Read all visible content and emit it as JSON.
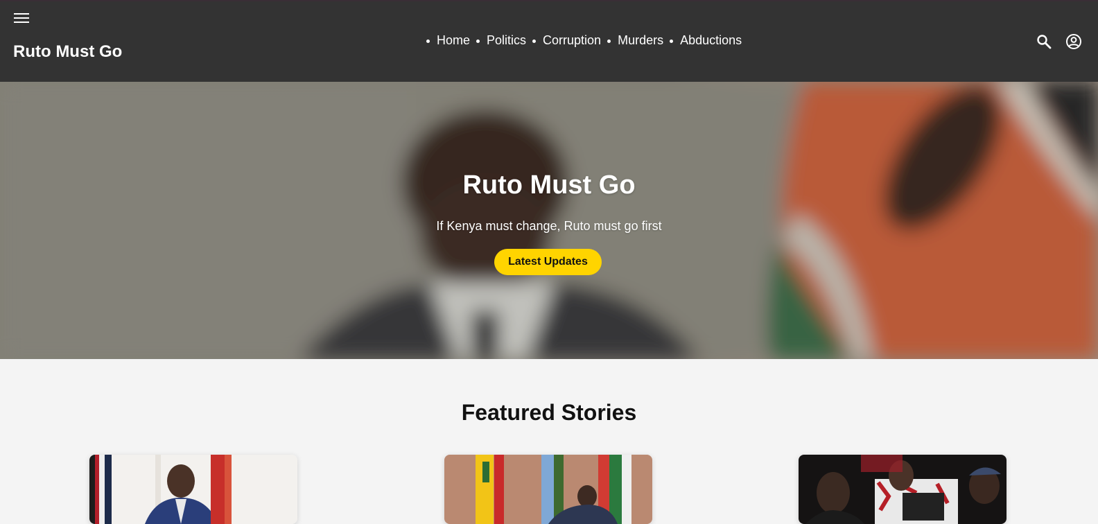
{
  "header": {
    "brand": "Ruto Must Go",
    "nav": [
      {
        "label": "Home"
      },
      {
        "label": "Politics"
      },
      {
        "label": "Corruption"
      },
      {
        "label": "Murders"
      },
      {
        "label": "Abductions"
      }
    ],
    "icons": {
      "menu": "menu-icon",
      "search": "search-icon",
      "account": "account-circle-icon"
    }
  },
  "hero": {
    "title": "Ruto Must Go",
    "subtitle": "If Kenya must change, Ruto must go first",
    "cta_label": "Latest Updates"
  },
  "featured": {
    "title": "Featured Stories",
    "cards": [
      {
        "image": "president-portrait-photo"
      },
      {
        "image": "signing-ceremony-photo"
      },
      {
        "image": "protest-crowd-photo"
      }
    ]
  },
  "colors": {
    "topbar": "#333333",
    "accent": "#ffd400",
    "background": "#f4f4f4"
  }
}
